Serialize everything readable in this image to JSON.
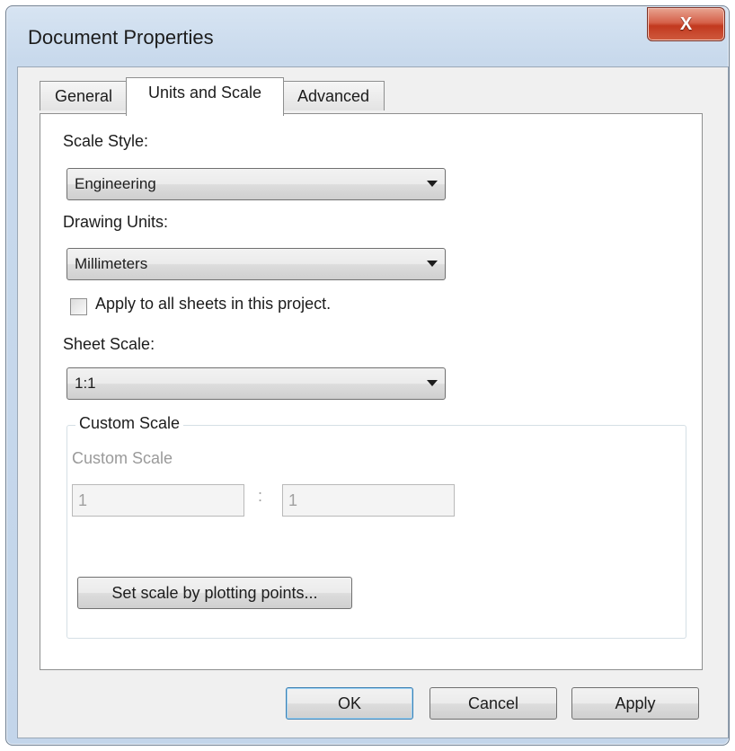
{
  "window": {
    "title": "Document Properties",
    "close_glyph": "X"
  },
  "tabs": [
    {
      "label": "General"
    },
    {
      "label": "Units and Scale",
      "active": true
    },
    {
      "label": "Advanced"
    }
  ],
  "scale_style": {
    "label": "Scale Style:",
    "value": "Engineering"
  },
  "drawing_units": {
    "label": "Drawing Units:",
    "value": "Millimeters"
  },
  "apply_all": {
    "label": "Apply to all sheets in this project.",
    "checked": false
  },
  "sheet_scale": {
    "label": "Sheet Scale:",
    "value": "1:1"
  },
  "custom_scale": {
    "group_title": "Custom Scale",
    "label": "Custom Scale",
    "left_value": "1",
    "separator": ":",
    "right_value": "1",
    "plot_button": "Set scale by plotting points..."
  },
  "buttons": {
    "ok": "OK",
    "cancel": "Cancel",
    "apply": "Apply"
  },
  "colors": {
    "close_button": "#c94a33",
    "frame": "#c8d9ec",
    "panel": "#ffffff"
  },
  "icons": {
    "close": "close-icon",
    "dropdown": "chevron-down-icon"
  }
}
